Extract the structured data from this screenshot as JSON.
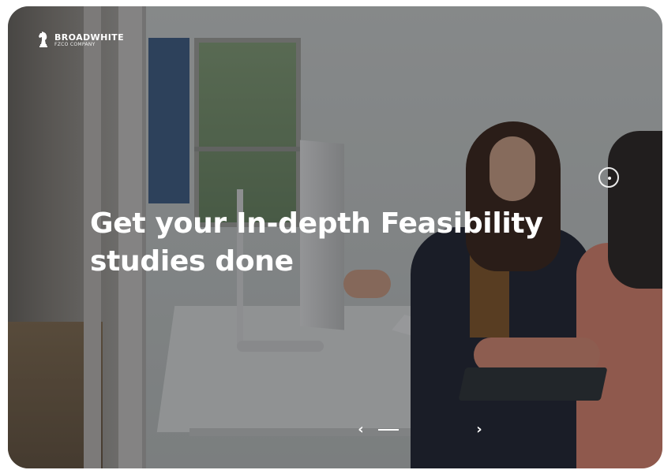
{
  "brand": {
    "name": "BROADWHITE",
    "subtitle": "FZCO COMPANY",
    "icon": "chess-knight-icon"
  },
  "hero": {
    "headline_line1": "Get your In-depth Feasibility",
    "headline_line2": "studies done"
  },
  "slider": {
    "prev_icon": "chevron-left-icon",
    "prev_glyph": "‹",
    "next_icon": "chevron-right-icon",
    "next_glyph": "›",
    "indicator_icon": "active-slide-indicator"
  },
  "colors": {
    "text": "#ffffff",
    "overlay": "#14161a"
  }
}
